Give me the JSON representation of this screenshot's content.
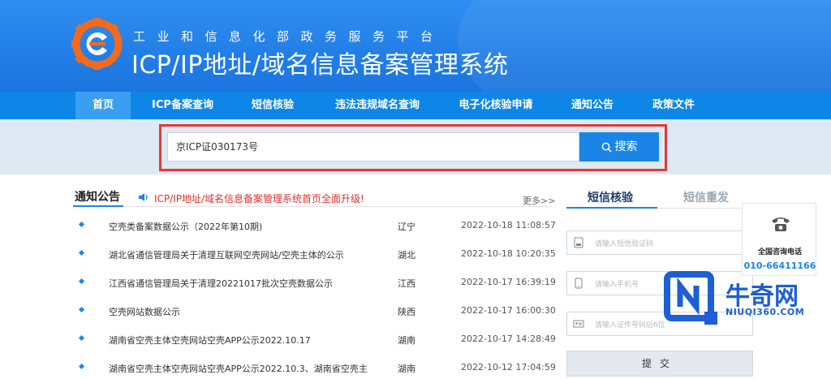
{
  "header": {
    "subtitle": "工业和信息化部政务服务平台",
    "title": "ICP/IP地址/域名信息备案管理系统"
  },
  "nav": [
    {
      "label": "首页",
      "active": true
    },
    {
      "label": "ICP备案查询"
    },
    {
      "label": "短信核验"
    },
    {
      "label": "违法违规域名查询"
    },
    {
      "label": "电子化核验申请"
    },
    {
      "label": "通知公告"
    },
    {
      "label": "政策文件"
    }
  ],
  "search": {
    "value": "京ICP证030173号",
    "button_label": "搜索"
  },
  "notices": {
    "title": "通知公告",
    "marquee": "ICP/IP地址/域名信息备案管理系统首页全面升级!",
    "more": "更多>>",
    "rows": [
      {
        "text": "空壳类备案数据公示（2022年第10期)",
        "province": "辽宁",
        "date": "2022-10-18 11:08:57"
      },
      {
        "text": "湖北省通信管理局关于清理互联网空壳网站/空壳主体的公示",
        "province": "湖北",
        "date": "2022-10-18 10:20:35"
      },
      {
        "text": "江西省通信管理局关于清理20221017批次空壳数据公示",
        "province": "江西",
        "date": "2022-10-17 16:39:19"
      },
      {
        "text": "空壳网站数据公示",
        "province": "陕西",
        "date": "2022-10-17 16:00:30"
      },
      {
        "text": "湖南省空壳主体空壳网站空壳APP公示2022.10.17",
        "province": "湖南",
        "date": "2022-10-17 14:28:49"
      },
      {
        "text": "湖南省空壳主体空壳网站空壳APP公示2022.10.3、湖南省空壳主",
        "province": "湖南",
        "date": "2022-10-12 17:04:59"
      }
    ]
  },
  "sms": {
    "tab_verify": "短信核验",
    "tab_resend": "短信重发",
    "code_placeholder": "请输入短信验证码",
    "phone_placeholder": "请输入手机号",
    "id_placeholder": "请输入证件号码后6位",
    "submit_label": "提交"
  },
  "hotline": {
    "label": "全国咨询电话",
    "number": "010-66411166"
  },
  "watermark": {
    "brand": "牛奇网",
    "url": "NIUQI360.COM"
  },
  "colors": {
    "banner": "#1a74df",
    "nav": "#0d86e8",
    "accent": "#1a85e6",
    "highlight": "#e53935",
    "marquee": "#e0322f"
  }
}
